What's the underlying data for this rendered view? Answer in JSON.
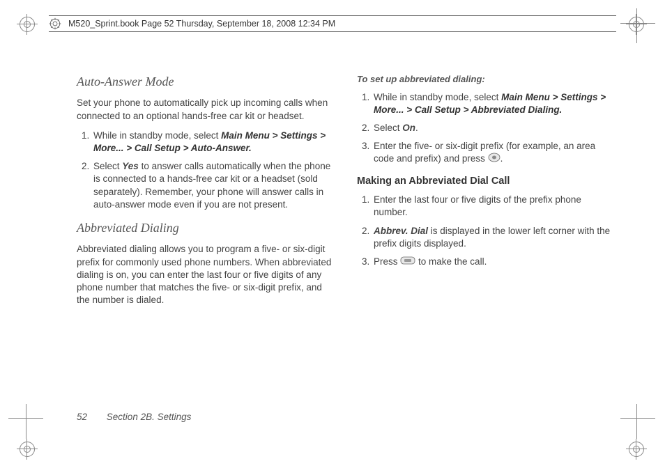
{
  "header": {
    "text": "M520_Sprint.book  Page 52  Thursday, September 18, 2008  12:34 PM"
  },
  "left": {
    "h1": "Auto-Answer Mode",
    "p1": "Set your phone to automatically pick up incoming calls when connected to an optional hands-free car kit or headset.",
    "li1a": "While in standby mode, select ",
    "li1b": "Main Menu > Settings > More... > Call Setup > Auto-Answer.",
    "li2a": "Select ",
    "li2yes": "Yes",
    "li2b": " to answer calls automatically when the phone is connected to a hands-free car kit or a headset (sold separately). Remember, your phone will answer calls in auto-answer mode even if you are not present.",
    "h2": "Abbreviated Dialing",
    "p2": "Abbreviated dialing allows you to program a five- or six-digit prefix for commonly used phone numbers. When abbreviated dialing is on, you can enter the last four or five digits of any phone number that matches the five- or six-digit prefix, and the number is dialed."
  },
  "right": {
    "lead": "To set up abbreviated dialing:",
    "li1a": "While in standby mode, select ",
    "li1b": "Main Menu > Settings > More... > Call Setup > Abbreviated Dialing.",
    "li2a": "Select ",
    "li2on": "On",
    "li2b": ".",
    "li3a": "Enter the five- or six-digit prefix (for example, an area code and prefix) and press ",
    "li3b": ".",
    "h3": "Making an Abbreviated Dial Call",
    "m1": "Enter the last four or five digits of the prefix phone number.",
    "m2a": "Abbrev. Dial",
    "m2b": " is displayed in the lower left corner with the prefix digits displayed.",
    "m3a": "Press ",
    "m3b": " to make the call."
  },
  "footer": {
    "page": "52",
    "section": "Section 2B. Settings"
  }
}
